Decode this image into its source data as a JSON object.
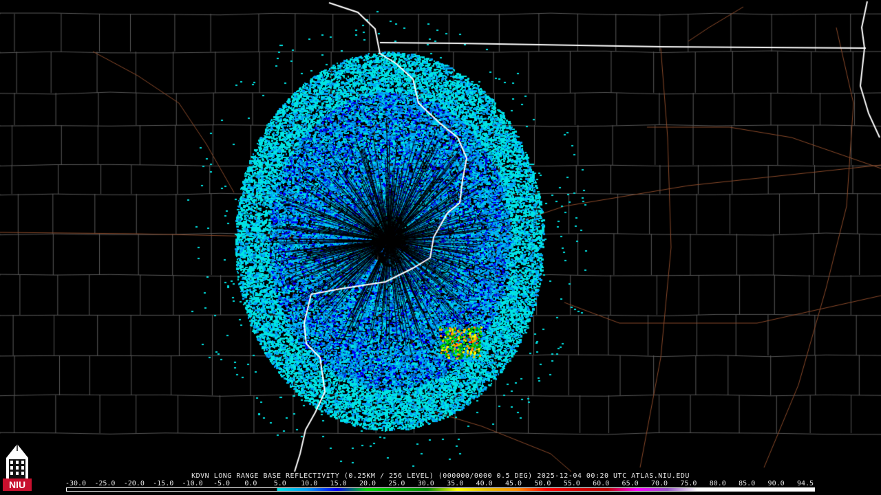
{
  "product": {
    "label": "KDVN LONG RANGE BASE REFLECTIVITY (0.25KM / 256 LEVEL) (000000/0000 0.5 DEG) 2025-12-04 00:20 UTC  ATLAS.NIU.EDU",
    "station": "KDVN",
    "elevation_deg": "0.5 DEG",
    "timestamp": "2025-12-04 00:20 UTC",
    "site": "ATLAS.NIU.EDU"
  },
  "logo": {
    "icon": "niu-tower-icon",
    "text": "NIU",
    "color": "#c8102e"
  },
  "colorscale": {
    "ticks": [
      "-30.0",
      "-25.0",
      "-20.0",
      "-15.0",
      "-10.0",
      "-5.0",
      "0.0",
      "5.0",
      "10.0",
      "15.0",
      "20.0",
      "25.0",
      "30.0",
      "35.0",
      "40.0",
      "45.0",
      "50.0",
      "55.0",
      "60.0",
      "65.0",
      "70.0",
      "75.0",
      "80.0",
      "85.0",
      "90.0",
      "94.5"
    ],
    "min": -30,
    "max": 94.5,
    "stops": [
      {
        "value": -30,
        "color": "#000000"
      },
      {
        "value": 5,
        "color": "#000000"
      },
      {
        "value": 5,
        "color": "#00e3e3"
      },
      {
        "value": 10,
        "color": "#01a0f6"
      },
      {
        "value": 15,
        "color": "#0000f6"
      },
      {
        "value": 20,
        "color": "#00d800"
      },
      {
        "value": 25,
        "color": "#00b000"
      },
      {
        "value": 30,
        "color": "#008a00"
      },
      {
        "value": 35,
        "color": "#ffff00"
      },
      {
        "value": 40,
        "color": "#e7c000"
      },
      {
        "value": 45,
        "color": "#ff9000"
      },
      {
        "value": 50,
        "color": "#ff0000"
      },
      {
        "value": 55,
        "color": "#d60000"
      },
      {
        "value": 60,
        "color": "#c00000"
      },
      {
        "value": 65,
        "color": "#ff00ff"
      },
      {
        "value": 70,
        "color": "#9955c9"
      },
      {
        "value": 75,
        "color": "#ffffff"
      },
      {
        "value": 94.5,
        "color": "#ffffff"
      }
    ]
  },
  "colors": {
    "background": "#000000",
    "county_lines": "#5a5a5a",
    "state_lines": "#ffffff",
    "highways": "#8b4a2a"
  }
}
